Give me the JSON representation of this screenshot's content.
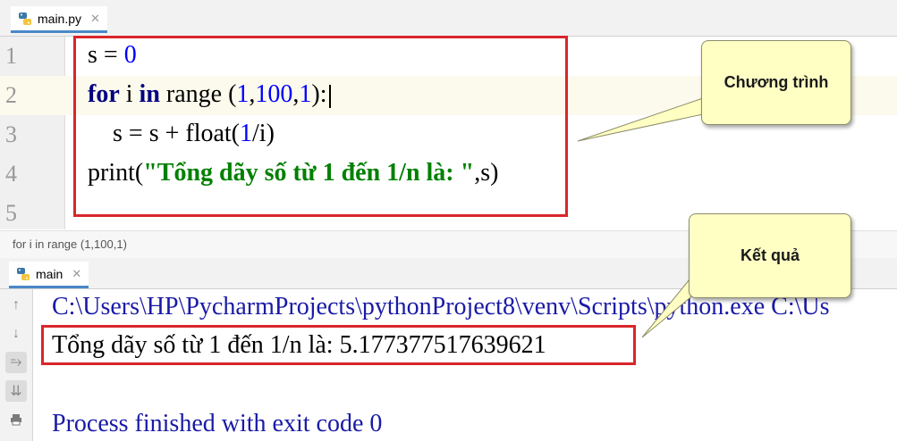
{
  "editor_tab": {
    "file_name": "main.py"
  },
  "editor": {
    "lines": [
      {
        "number": "1",
        "tokens": [
          "s = ",
          "0"
        ]
      },
      {
        "number": "2",
        "tokens": [
          "for",
          " i ",
          "in",
          " range ",
          "(",
          "1",
          ",",
          "100",
          ",",
          "1",
          "):"
        ]
      },
      {
        "number": "3",
        "tokens": [
          "    s = s + float(",
          "1",
          "/i)"
        ]
      },
      {
        "number": "4",
        "tokens": [
          "print(",
          "\"Tổng dãy số từ 1 đến 1/n là: \"",
          ",s)"
        ]
      },
      {
        "number": "5",
        "tokens": []
      }
    ]
  },
  "breadcrumb": "for i in range (1,100,1)",
  "run_tab": {
    "label": "main"
  },
  "console": {
    "command": "C:\\Users\\HP\\PycharmProjects\\pythonProject8\\venv\\Scripts\\python.exe C:\\Us",
    "output": "Tổng dãy số từ 1 đến 1/n là:  5.177377517639621",
    "finished": "Process finished with exit code 0"
  },
  "callouts": {
    "program": "Chương trình",
    "result": "Kết quả"
  },
  "icons": {
    "file": "python-file-icon",
    "run": "python-run-icon",
    "toolbar": [
      "arrow-up-icon",
      "arrow-down-icon",
      "soft-wrap-icon",
      "scroll-to-end-icon",
      "print-icon"
    ]
  },
  "colors": {
    "annotation_red": "#d9262c",
    "callout_fill": "#ffffc4",
    "keyword": "#000080",
    "number": "#0000ff",
    "string": "#008000"
  }
}
